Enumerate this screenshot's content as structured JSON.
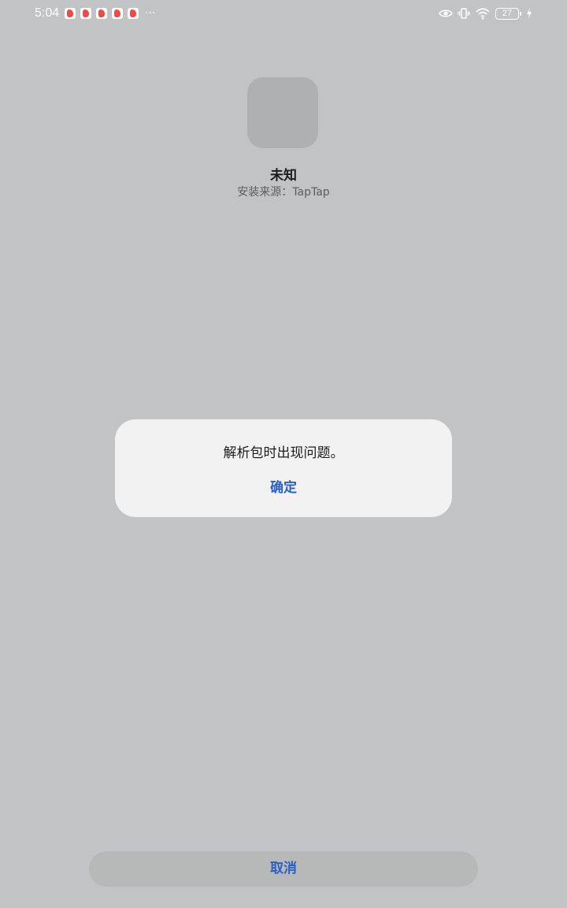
{
  "status_bar": {
    "time": "5:04",
    "notification_icons": [
      "app-notification-icon",
      "app-notification-icon",
      "app-notification-icon",
      "app-notification-icon",
      "app-notification-icon"
    ],
    "more_indicator": "···",
    "battery_level": "27",
    "status_icons": [
      "eye-icon",
      "vibrate-icon",
      "wifi-icon",
      "battery-icon",
      "charging-icon"
    ]
  },
  "app": {
    "name": "未知",
    "install_source": "安装来源：TapTap"
  },
  "dialog": {
    "message": "解析包时出现问题。",
    "ok_label": "确定"
  },
  "footer": {
    "cancel_label": "取消"
  },
  "colors": {
    "background": "#c2c3c5",
    "dialog_bg": "#f1f2f1",
    "accent": "#2c5fc3",
    "notification_red": "#ef4a48"
  }
}
